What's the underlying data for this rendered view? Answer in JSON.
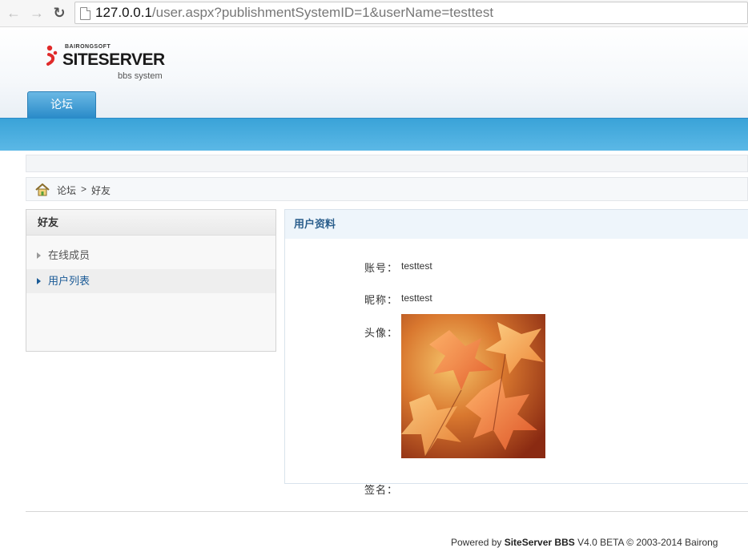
{
  "browser": {
    "url_host": "127.0.0.1",
    "url_path": "/user.aspx?publishmentSystemID=1&userName=testtest"
  },
  "header": {
    "logo_top": "BAIRONGSOFT",
    "logo_main": "SITESERVER",
    "logo_sub": "bbs system",
    "main_tab": "论坛"
  },
  "breadcrumb": {
    "root": "论坛",
    "separator": ">",
    "current": "好友"
  },
  "sidebar": {
    "title": "好友",
    "items": [
      {
        "label": "在线成员"
      },
      {
        "label": "用户列表"
      }
    ]
  },
  "profile": {
    "title": "用户资料",
    "account_label": "账号：",
    "account_value": "testtest",
    "nickname_label": "昵称：",
    "nickname_value": "testtest",
    "avatar_label": "头像：",
    "signature_label": "签名："
  },
  "footer": {
    "prefix": "Powered by ",
    "brand": "SiteServer BBS",
    "suffix": " V4.0 BETA © 2003-2014 Bairong"
  },
  "colors": {
    "accent_blue": "#3aa3d8",
    "link_blue": "#1a5a96",
    "logo_red": "#e02a2a"
  }
}
